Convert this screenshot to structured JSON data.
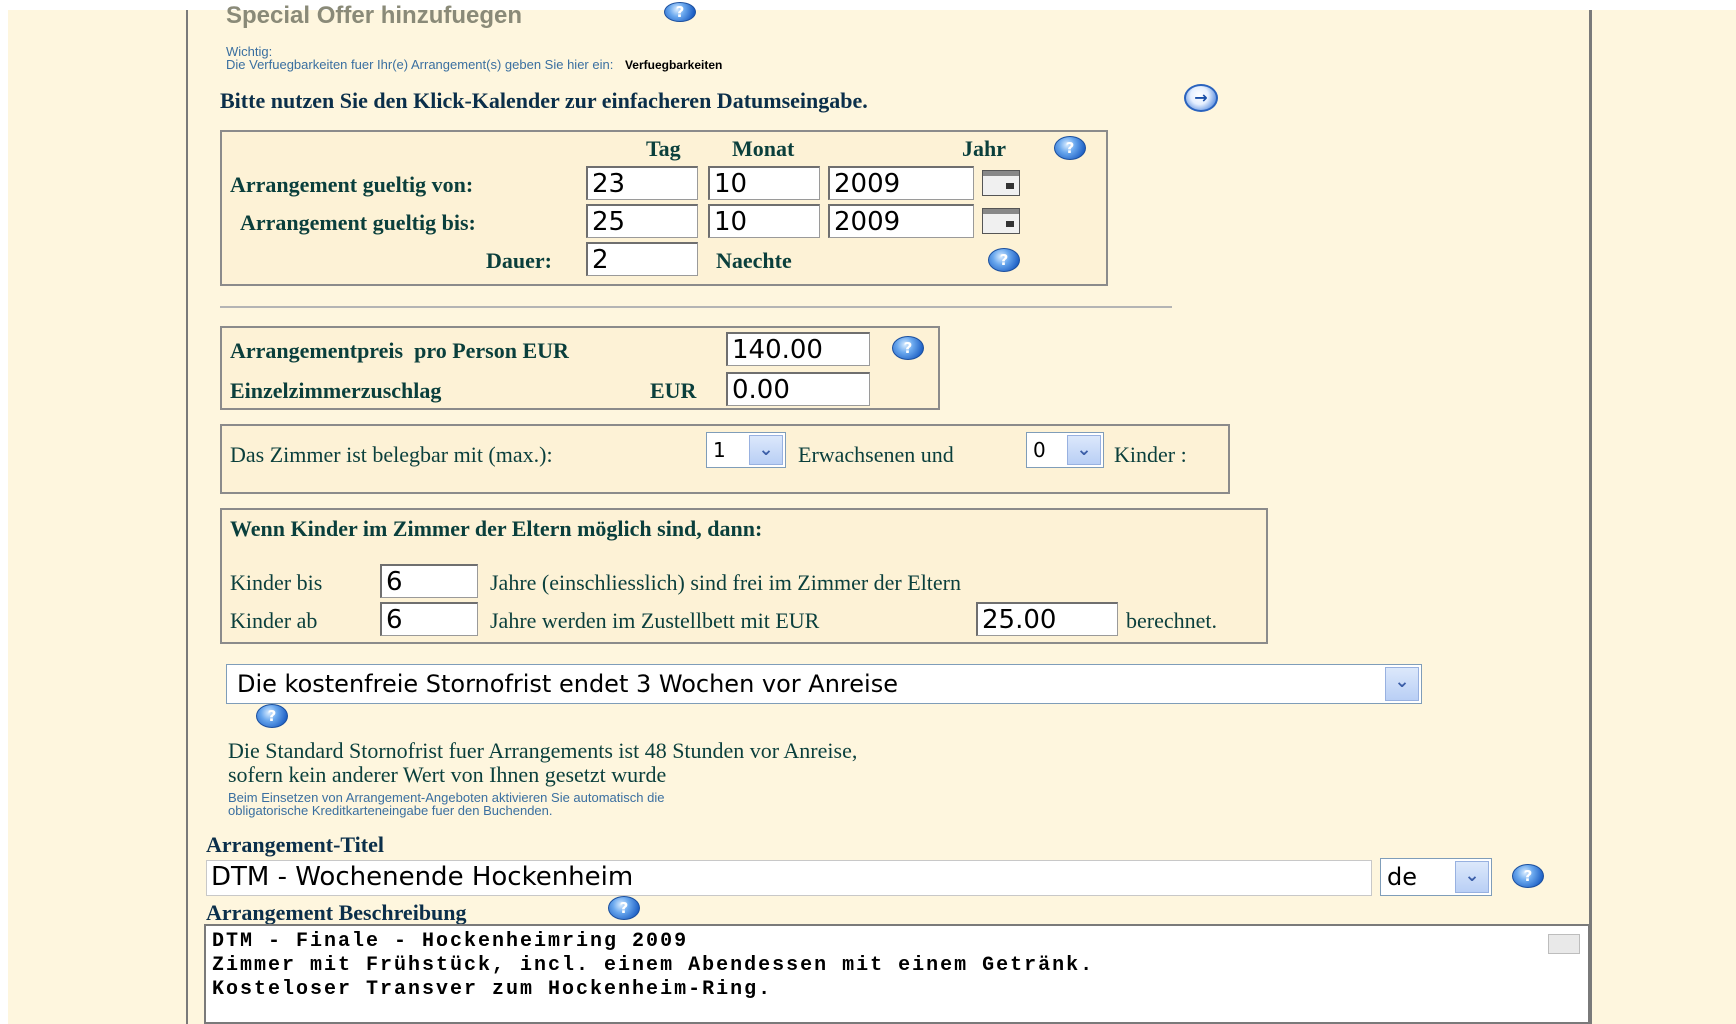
{
  "header": {
    "title": "Special Offer hinzufuegen",
    "important_label": "Wichtig:",
    "availability_text": "Die Verfuegbarkeiten fuer Ihr(e) Arrangement(s) geben Sie hier ein:",
    "availability_link": "Verfuegbarkeiten",
    "calendar_hint": "Bitte nutzen Sie den Klick-Kalender zur einfacheren Datumseingabe."
  },
  "dates": {
    "col_day": "Tag",
    "col_month": "Monat",
    "col_year": "Jahr",
    "from_label": "Arrangement gueltig von:",
    "from_day": "23",
    "from_month": "10",
    "from_year": "2009",
    "to_label": "Arrangement gueltig bis:",
    "to_day": "25",
    "to_month": "10",
    "to_year": "2009",
    "duration_label": "Dauer:",
    "duration_value": "2",
    "nights_label": "Naechte"
  },
  "price": {
    "price_label": "Arrangementpreis  pro Person EUR",
    "price_value": "140.00",
    "single_label": "Einzelzimmerzuschlag",
    "single_currency": "EUR",
    "single_value": "0.00"
  },
  "occupancy": {
    "text_before": "Das Zimmer ist belegbar mit (max.):",
    "adults": "1",
    "text_mid": "Erwachsenen und",
    "children": "0",
    "text_after": "Kinder :"
  },
  "children": {
    "heading": "Wenn Kinder im Zimmer der Eltern möglich sind, dann:",
    "free_label": "Kinder bis",
    "free_age": "6",
    "free_text": "Jahre (einschliesslich) sind frei im Zimmer der Eltern",
    "bed_label": "Kinder ab",
    "bed_age": "6",
    "bed_text": "Jahre werden im Zustellbett mit EUR",
    "bed_price": "25.00",
    "bed_suffix": "berechnet."
  },
  "cancellation": {
    "selected": "Die kostenfreie Stornofrist endet 3 Wochen vor Anreise",
    "info_line1": "Die Standard Stornofrist fuer Arrangements ist 48 Stunden vor Anreise,",
    "info_line2": "sofern kein anderer Wert von Ihnen gesetzt wurde",
    "note_line1": "Beim Einsetzen von Arrangement-Angeboten aktivieren Sie automatisch die",
    "note_line2": "obligatorische Kreditkarteneingabe fuer den Buchenden."
  },
  "title_section": {
    "label": "Arrangement-Titel",
    "value": "DTM - Wochenende Hockenheim",
    "language": "de"
  },
  "description": {
    "label": "Arrangement Beschreibung",
    "line1": "DTM - Finale - Hockenheimring 2009",
    "line2": "Zimmer mit Frühstück, incl. einem Abendessen mit einem Getränk.",
    "line3": "Kosteloser Transver zum Hockenheim-Ring."
  },
  "icons": {
    "help": "?",
    "arrow": "→",
    "dropdown": "⌄"
  }
}
